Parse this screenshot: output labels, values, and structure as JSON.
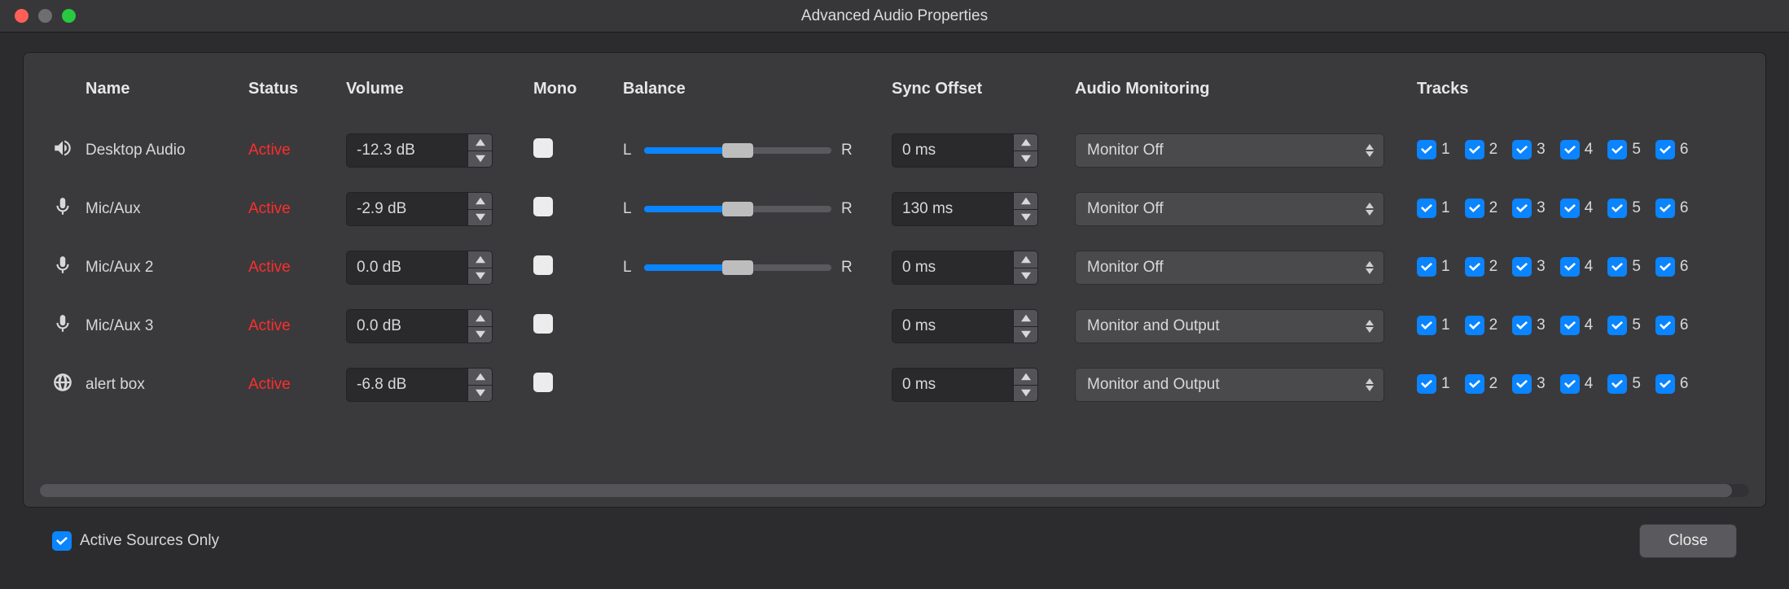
{
  "window": {
    "title": "Advanced Audio Properties"
  },
  "columns": {
    "name": "Name",
    "status": "Status",
    "volume": "Volume",
    "mono": "Mono",
    "balance": "Balance",
    "sync": "Sync Offset",
    "monitor": "Audio Monitoring",
    "tracks": "Tracks"
  },
  "balance_labels": {
    "left": "L",
    "right": "R"
  },
  "track_numbers": [
    "1",
    "2",
    "3",
    "4",
    "5",
    "6"
  ],
  "rows": [
    {
      "icon": "speaker",
      "name": "Desktop Audio",
      "status": "Active",
      "volume": "-12.3 dB",
      "mono": false,
      "balance_visible": true,
      "balance_pct": 50,
      "sync": "0 ms",
      "monitor": "Monitor Off",
      "tracks": [
        true,
        true,
        true,
        true,
        true,
        true
      ]
    },
    {
      "icon": "mic",
      "name": "Mic/Aux",
      "status": "Active",
      "volume": "-2.9 dB",
      "mono": false,
      "balance_visible": true,
      "balance_pct": 50,
      "sync": "130 ms",
      "monitor": "Monitor Off",
      "tracks": [
        true,
        true,
        true,
        true,
        true,
        true
      ]
    },
    {
      "icon": "mic",
      "name": "Mic/Aux 2",
      "status": "Active",
      "volume": "0.0 dB",
      "mono": false,
      "balance_visible": true,
      "balance_pct": 50,
      "sync": "0 ms",
      "monitor": "Monitor Off",
      "tracks": [
        true,
        true,
        true,
        true,
        true,
        true
      ]
    },
    {
      "icon": "mic",
      "name": "Mic/Aux 3",
      "status": "Active",
      "volume": "0.0 dB",
      "mono": false,
      "balance_visible": false,
      "balance_pct": 50,
      "sync": "0 ms",
      "monitor": "Monitor and Output",
      "tracks": [
        true,
        true,
        true,
        true,
        true,
        true
      ]
    },
    {
      "icon": "globe",
      "name": "alert box",
      "status": "Active",
      "volume": "-6.8 dB",
      "mono": false,
      "balance_visible": false,
      "balance_pct": 50,
      "sync": "0 ms",
      "monitor": "Monitor and Output",
      "tracks": [
        true,
        true,
        true,
        true,
        true,
        true
      ]
    }
  ],
  "footer": {
    "active_only_label": "Active Sources Only",
    "active_only_checked": true,
    "close": "Close"
  }
}
